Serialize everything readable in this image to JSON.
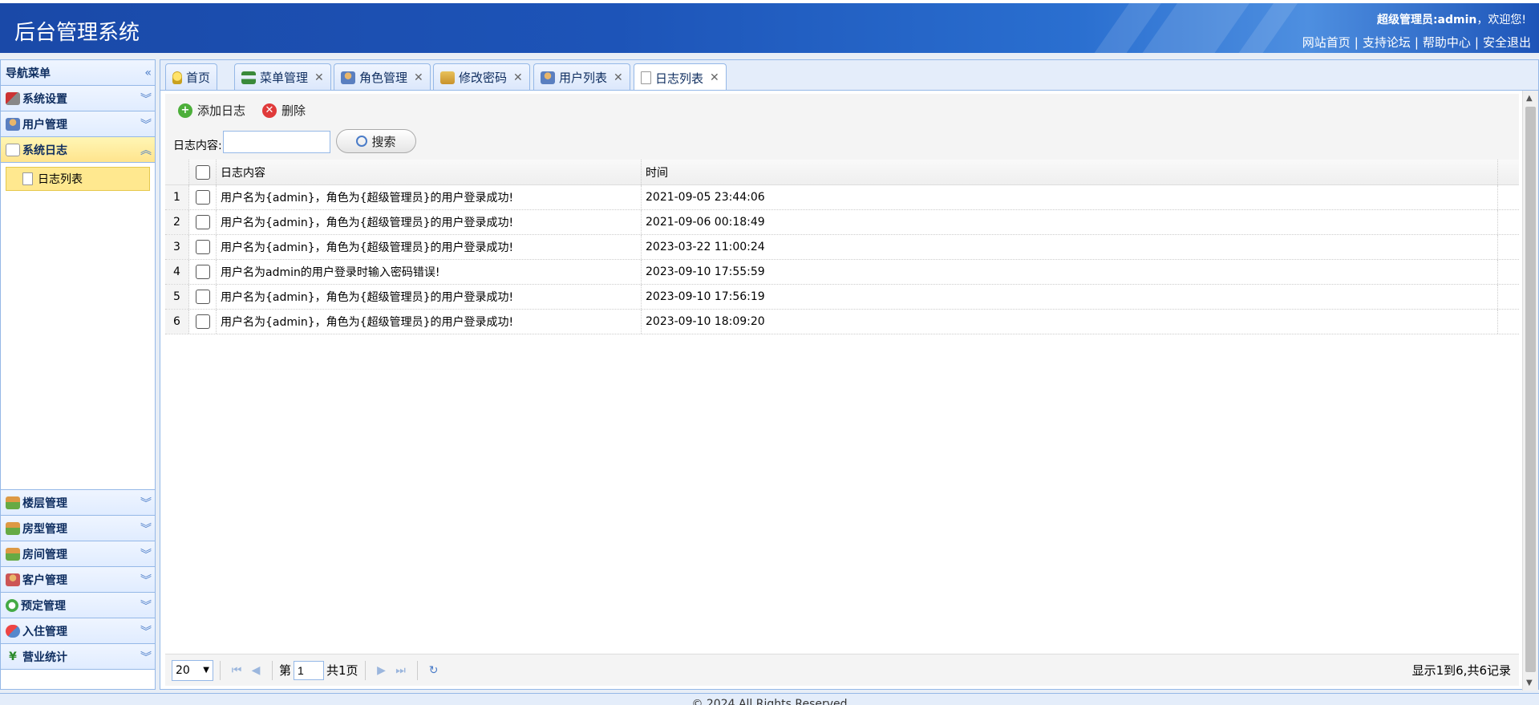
{
  "header": {
    "title": "后台管理系统",
    "welcome_user": "超级管理员:admin",
    "welcome_suffix": "，欢迎您!",
    "links": [
      "网站首页",
      "支持论坛",
      "帮助中心",
      "安全退出"
    ]
  },
  "sidebar": {
    "title": "导航菜单",
    "collapse_glyph": "«",
    "top_groups": [
      {
        "label": "系统设置",
        "icon": "tools-icon"
      },
      {
        "label": "用户管理",
        "icon": "user-icon"
      },
      {
        "label": "系统日志",
        "icon": "log-icon",
        "active": true
      }
    ],
    "active_item": "日志列表",
    "bottom_groups": [
      {
        "label": "楼层管理",
        "icon": "house-icon"
      },
      {
        "label": "房型管理",
        "icon": "house-icon"
      },
      {
        "label": "房间管理",
        "icon": "house-icon"
      },
      {
        "label": "客户管理",
        "icon": "customer-icon"
      },
      {
        "label": "预定管理",
        "icon": "clock-icon"
      },
      {
        "label": "入住管理",
        "icon": "checkin-icon"
      },
      {
        "label": "营业统计",
        "icon": "yen-icon"
      }
    ]
  },
  "tabs": [
    {
      "label": "首页",
      "icon": "bulb-icon",
      "closable": false
    },
    {
      "label": "菜单管理",
      "icon": "tree-icon",
      "closable": true
    },
    {
      "label": "角色管理",
      "icon": "role-icon",
      "closable": true
    },
    {
      "label": "修改密码",
      "icon": "key-icon",
      "closable": true
    },
    {
      "label": "用户列表",
      "icon": "user-icon",
      "closable": true
    },
    {
      "label": "日志列表",
      "icon": "page-icon",
      "closable": true,
      "active": true
    }
  ],
  "toolbar": {
    "add_label": "添加日志",
    "delete_label": "删除",
    "search_label": "日志内容:",
    "search_value": "",
    "search_button": "搜索"
  },
  "grid": {
    "columns": [
      "日志内容",
      "时间"
    ],
    "rows": [
      {
        "num": "1",
        "content": "用户名为{admin}，角色为{超级管理员}的用户登录成功!",
        "time": "2021-09-05 23:44:06"
      },
      {
        "num": "2",
        "content": "用户名为{admin}，角色为{超级管理员}的用户登录成功!",
        "time": "2021-09-06 00:18:49"
      },
      {
        "num": "3",
        "content": "用户名为{admin}，角色为{超级管理员}的用户登录成功!",
        "time": "2023-03-22 11:00:24"
      },
      {
        "num": "4",
        "content": "用户名为admin的用户登录时输入密码错误!",
        "time": "2023-09-10 17:55:59"
      },
      {
        "num": "5",
        "content": "用户名为{admin}，角色为{超级管理员}的用户登录成功!",
        "time": "2023-09-10 17:56:19"
      },
      {
        "num": "6",
        "content": "用户名为{admin}，角色为{超级管理员}的用户登录成功!",
        "time": "2023-09-10 18:09:20"
      }
    ]
  },
  "pager": {
    "page_size": "20",
    "page_prefix": "第",
    "page_value": "1",
    "page_total": "共1页",
    "info": "显示1到6,共6记录"
  },
  "footer": {
    "text": "© 2024 All Rights Reserved"
  }
}
